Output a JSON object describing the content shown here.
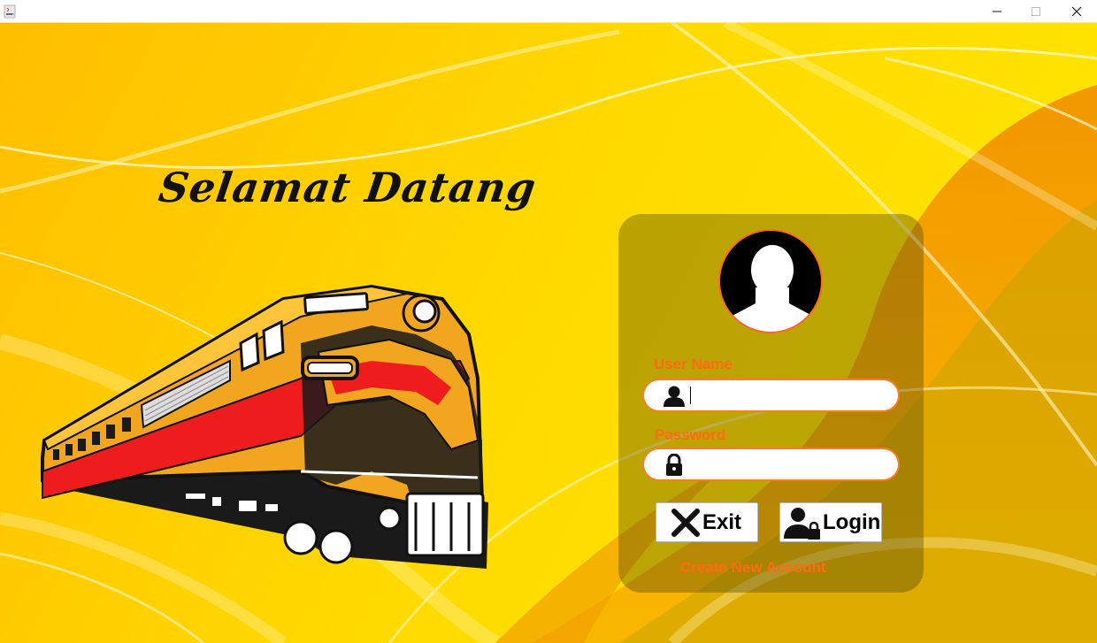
{
  "window": {
    "title": "",
    "controls": [
      "minimize",
      "maximize",
      "close"
    ]
  },
  "welcome": {
    "text": "Selamat Datang"
  },
  "login": {
    "username_label": "User Name",
    "username_value": "",
    "password_label": "Password",
    "password_value": "",
    "exit_label": "Exit",
    "login_label": "Login",
    "create_account_label": "Create New Account"
  },
  "icons": {
    "app": "java-cup-icon",
    "user_field": "user-icon",
    "password_field": "lock-icon",
    "exit": "close-x-icon",
    "login": "user-lock-icon",
    "avatar": "avatar-silhouette-icon"
  },
  "colors": {
    "background_yellow": "#ffc400",
    "accent_orange": "#ff6a14",
    "panel_overlay": "#50460a",
    "train_red": "#ee1c1c",
    "train_yellow": "#f2a51e"
  }
}
